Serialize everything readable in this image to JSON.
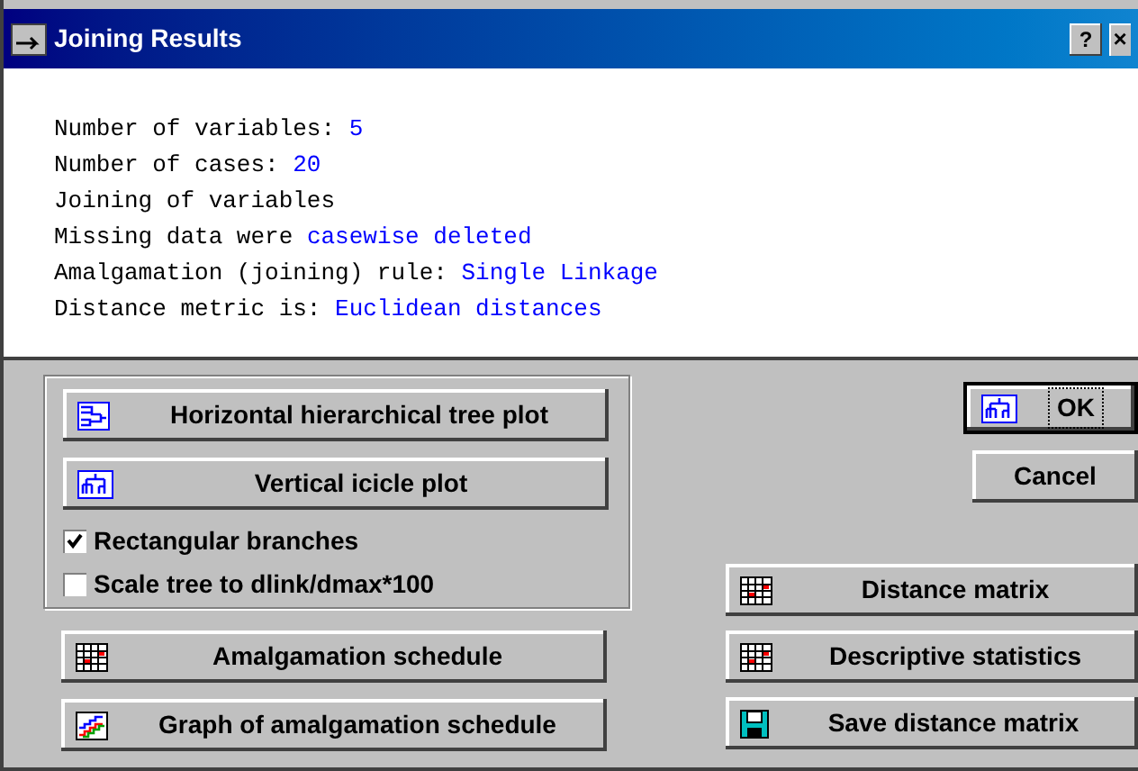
{
  "window": {
    "title": "Joining Results",
    "help_button": "?",
    "close_button": "×"
  },
  "output": [
    {
      "label": "Number of variables: ",
      "value": "5"
    },
    {
      "label": "Number of cases: ",
      "value": "20"
    },
    {
      "label": "Joining of variables"
    },
    {
      "label": "Missing data were ",
      "value": "casewise deleted"
    },
    {
      "label": "Amalgamation (joining) rule: ",
      "value": "Single Linkage"
    },
    {
      "label": "Distance metric is: ",
      "value": "Euclidean distances"
    }
  ],
  "plot_group": {
    "buttons": [
      {
        "label": "Horizontal hierarchical tree plot",
        "kind": "htree"
      },
      {
        "label": "Vertical icicle plot",
        "kind": "icicle"
      }
    ],
    "checkboxes": [
      {
        "label": "Rectangular branches",
        "checked": true
      },
      {
        "label": "Scale tree to dlink/dmax*100",
        "checked": false
      }
    ]
  },
  "left_buttons": [
    {
      "label": "Amalgamation schedule",
      "kind": "table"
    },
    {
      "label": "Graph of amalgamation schedule",
      "kind": "graph"
    }
  ],
  "dialog_buttons": [
    {
      "label": "OK",
      "kind": "icicle",
      "default": true
    },
    {
      "label": "Cancel",
      "default": false
    }
  ],
  "right_buttons": [
    {
      "label": "Distance matrix",
      "kind": "table"
    },
    {
      "label": "Descriptive statistics",
      "kind": "table"
    },
    {
      "label": "Save distance matrix",
      "kind": "floppy"
    }
  ]
}
